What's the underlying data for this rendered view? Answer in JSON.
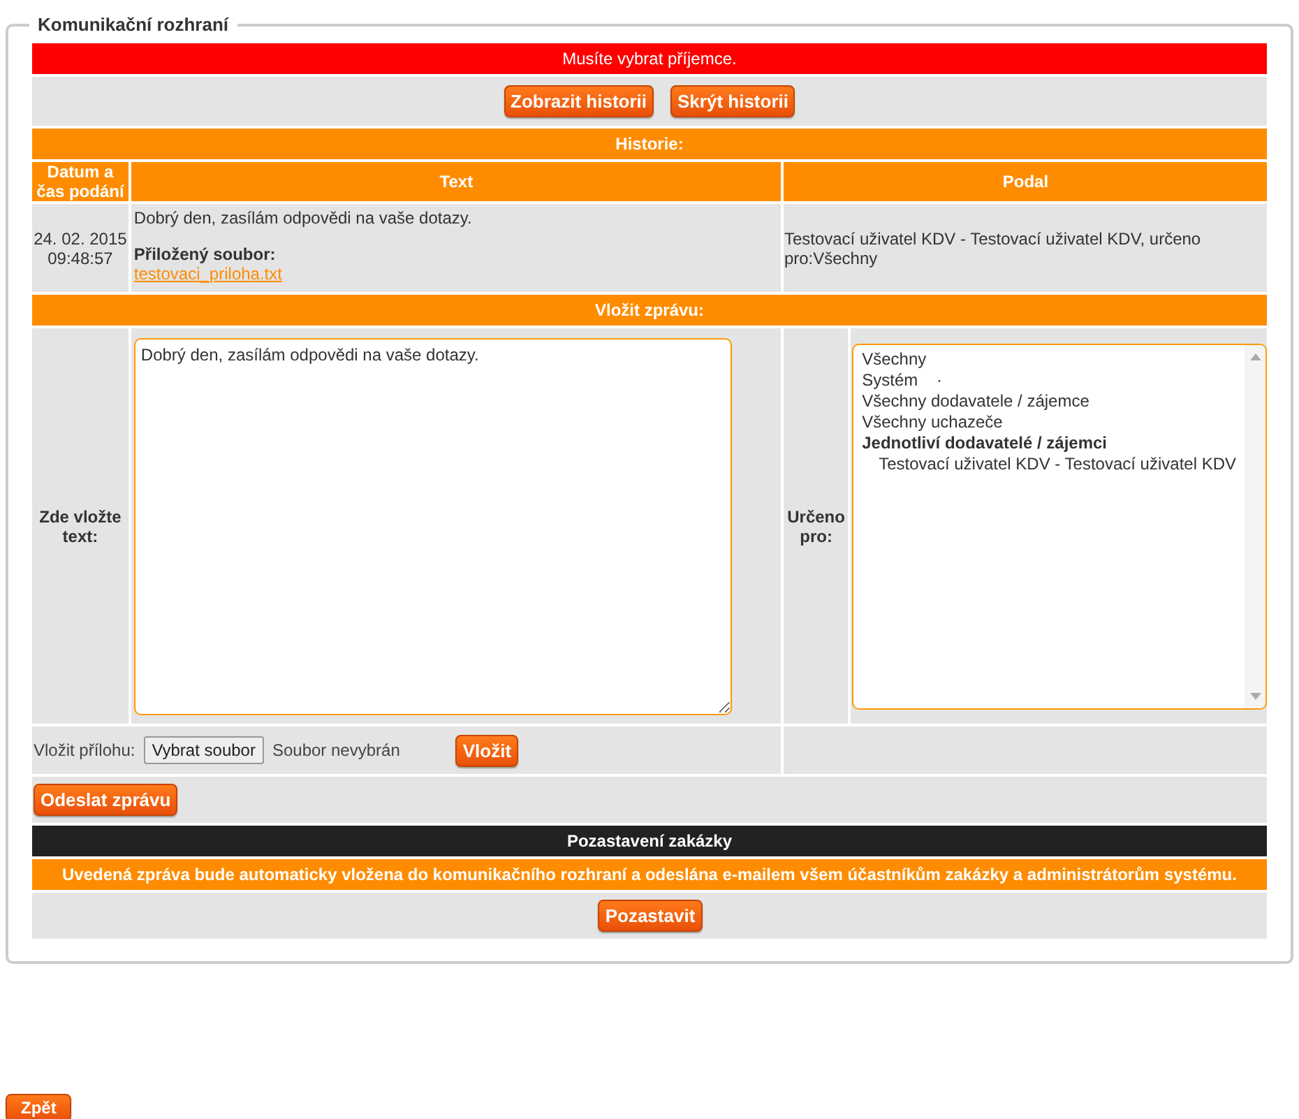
{
  "panel": {
    "title": "Komunikační rozhraní"
  },
  "error": "Musíte vybrat příjemce.",
  "history_buttons": [
    "Zobrazit historii",
    "Skrýt historii"
  ],
  "history": {
    "title": "Historie:",
    "columns": [
      "Datum a čas podání",
      "Text",
      "Podal"
    ],
    "rows": [
      {
        "date": "24. 02. 2015",
        "time": "09:48:57",
        "text": "Dobrý den, zasílám odpovědi na vaše dotazy.",
        "attachment_label": "Přiložený soubor:",
        "attachment": "testovaci_priloha.txt",
        "author": "Testovací uživatel KDV - Testovací uživatel KDV, určeno pro:Všechny"
      }
    ]
  },
  "compose": {
    "title": "Vložit zprávu:",
    "text_label": "Zde vložte text:",
    "message": "Dobrý den, zasílám odpovědi na vaše dotazy.",
    "recipients_label": "Určeno pro:",
    "recipients": [
      {
        "kind": "option",
        "label": "Všechny"
      },
      {
        "kind": "option",
        "label": "Systém    ·"
      },
      {
        "kind": "option",
        "label": "Všechny dodavatele / zájemce"
      },
      {
        "kind": "option",
        "label": "Všechny uchazeče"
      },
      {
        "kind": "group",
        "label": "Jednotliví dodavatelé / zájemci",
        "children": [
          {
            "kind": "option",
            "label": "Testovací uživatel KDV - Testovací uživatel KDV"
          }
        ]
      }
    ],
    "attach_label": "Vložit přílohu:",
    "file_button": "Vybrat soubor",
    "file_status": "Soubor nevybrán",
    "insert_button": "Vložit",
    "send_button": "Odeslat zprávu"
  },
  "suspend": {
    "title": "Pozastavení zakázky",
    "notice": "Uvedená zpráva bude automaticky vložena do komunikačního rozhraní a odeslána e-mailem všem účastníkům zakázky a administrátorům systému.",
    "button": "Pozastavit"
  },
  "back_button": "Zpět"
}
